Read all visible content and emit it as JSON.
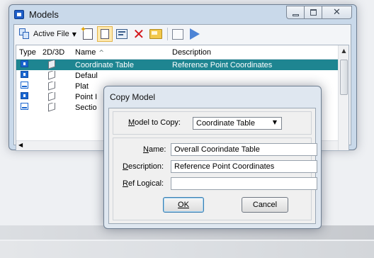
{
  "models_window": {
    "title": "Models",
    "toolbar": {
      "active_file_label": "Active File"
    },
    "columns": [
      "Type",
      "2D/3D",
      "Name",
      "Description"
    ],
    "rows": [
      {
        "name": "Coordinate Table",
        "description": "Reference Point Coordinates",
        "type_icon": "design-model-icon",
        "selected": true
      },
      {
        "name": "Defaul",
        "description": "",
        "type_icon": "design-model-icon",
        "selected": false
      },
      {
        "name": "Plat",
        "description": "",
        "type_icon": "sheet-model-icon",
        "selected": false
      },
      {
        "name": "Point I",
        "description": "",
        "type_icon": "design-model-icon",
        "selected": false
      },
      {
        "name": "Sectio",
        "description": "",
        "type_icon": "sheet-model-icon",
        "selected": false
      }
    ]
  },
  "copy_dialog": {
    "title": "Copy Model",
    "model_to_copy_label": "Model to Copy:",
    "model_to_copy_value": "Coordinate Table",
    "name_label": "Name:",
    "name_value": "Overall Coorindate Table",
    "description_label": "Description:",
    "description_value": "Reference Point Coordinates",
    "ref_logical_label": "Ref Logical:",
    "ref_logical_value": "",
    "ok_label": "OK",
    "cancel_label": "Cancel"
  },
  "colors": {
    "selection": "#1e8591",
    "frame": "#c9d9ea",
    "delete_red": "#d3161b"
  }
}
